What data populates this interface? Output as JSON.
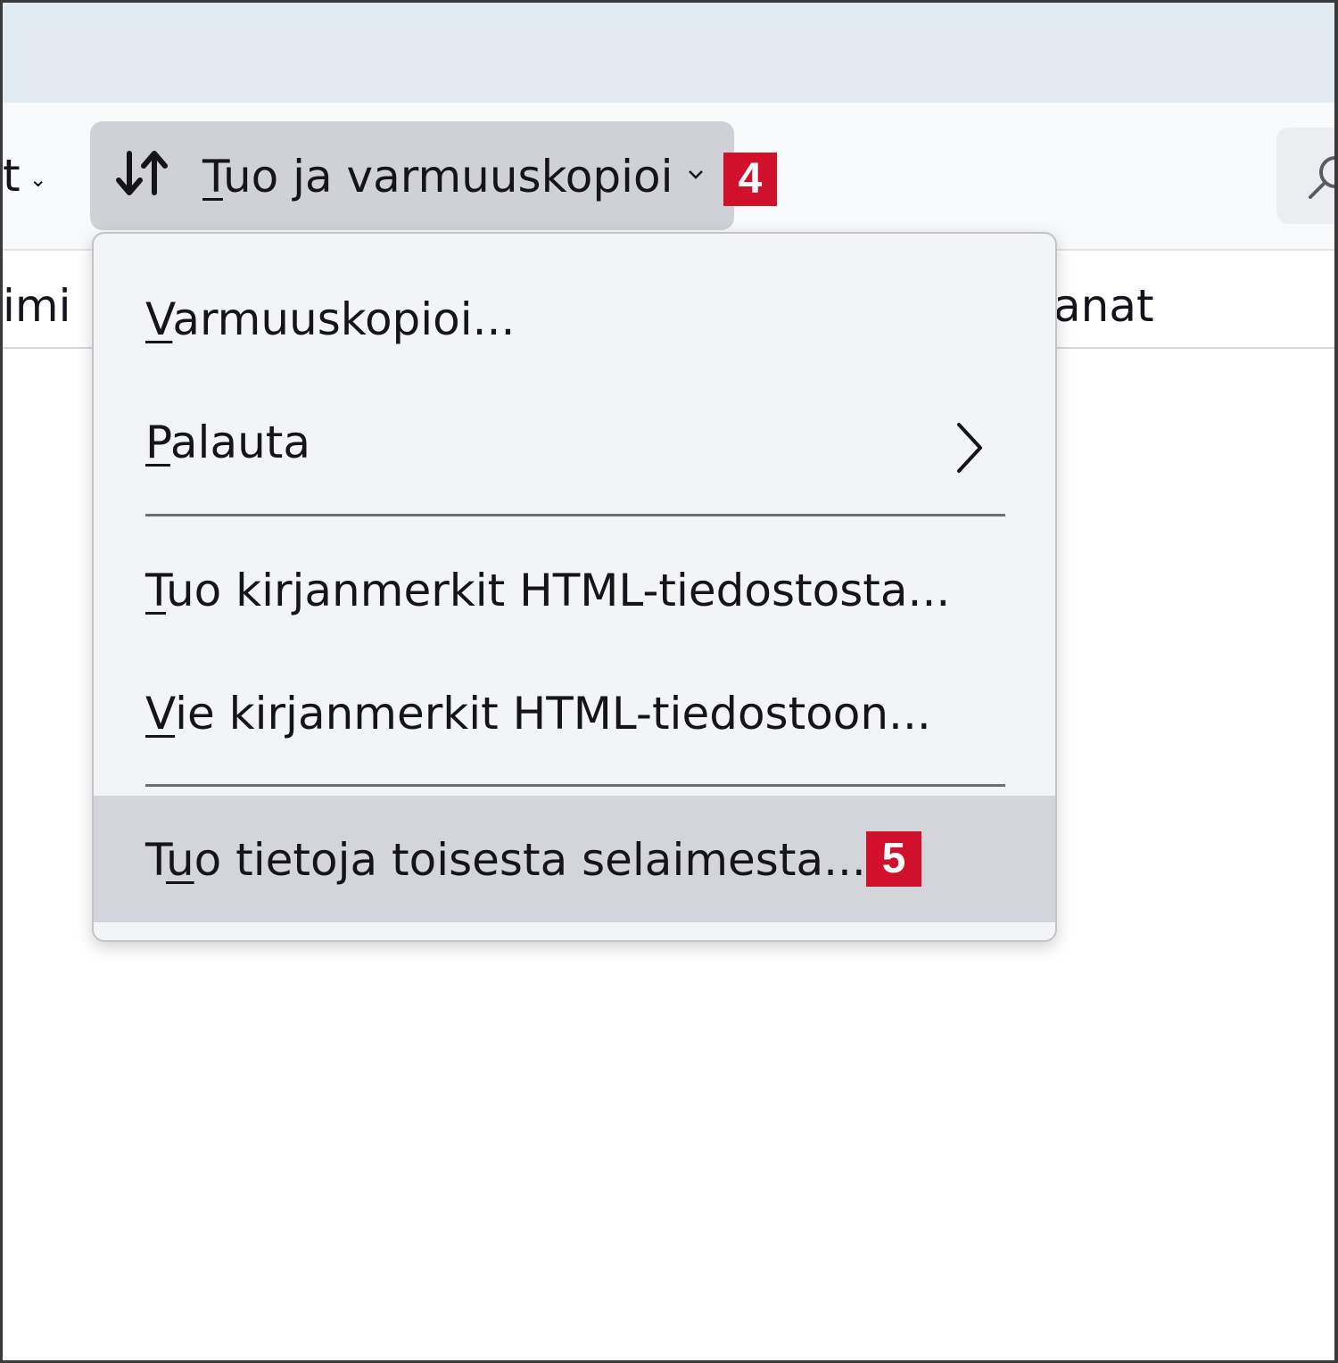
{
  "toolbar": {
    "organize_partial_label": "t",
    "import_backup_label": "Tuo ja varmuuskopioi",
    "import_backup_underline": "T",
    "import_backup_rest": "uo ja varmuuskopioi",
    "callout_badge": "4"
  },
  "columns": {
    "name_partial": "imi",
    "keywords_partial": "anat"
  },
  "menu": {
    "items": [
      {
        "underline": "V",
        "rest": "armuuskopioi..."
      },
      {
        "underline": "P",
        "rest": "alauta",
        "has_submenu": true
      },
      {
        "underline": "T",
        "rest": "uo kirjanmerkit HTML-tiedostosta..."
      },
      {
        "underline": "V",
        "rest": "ie kirjanmerkit HTML-tiedostoon..."
      },
      {
        "before": "T",
        "underline": "u",
        "rest": "o tietoja toisesta selaimesta...",
        "highlighted": true,
        "callout_badge": "5"
      }
    ]
  },
  "colors": {
    "titlebar": "#e1ebf1",
    "toolbar": "#f8f9fa",
    "button_active": "#cfd1d6",
    "menu_bg": "#f3f4f6",
    "menu_hover": "#d3d5da",
    "badge": "#d1112c"
  },
  "icons": {
    "import_backup": "sort-arrows-icon",
    "dropdown": "chevron-down-icon",
    "submenu": "chevron-right-icon",
    "search": "search-icon"
  }
}
